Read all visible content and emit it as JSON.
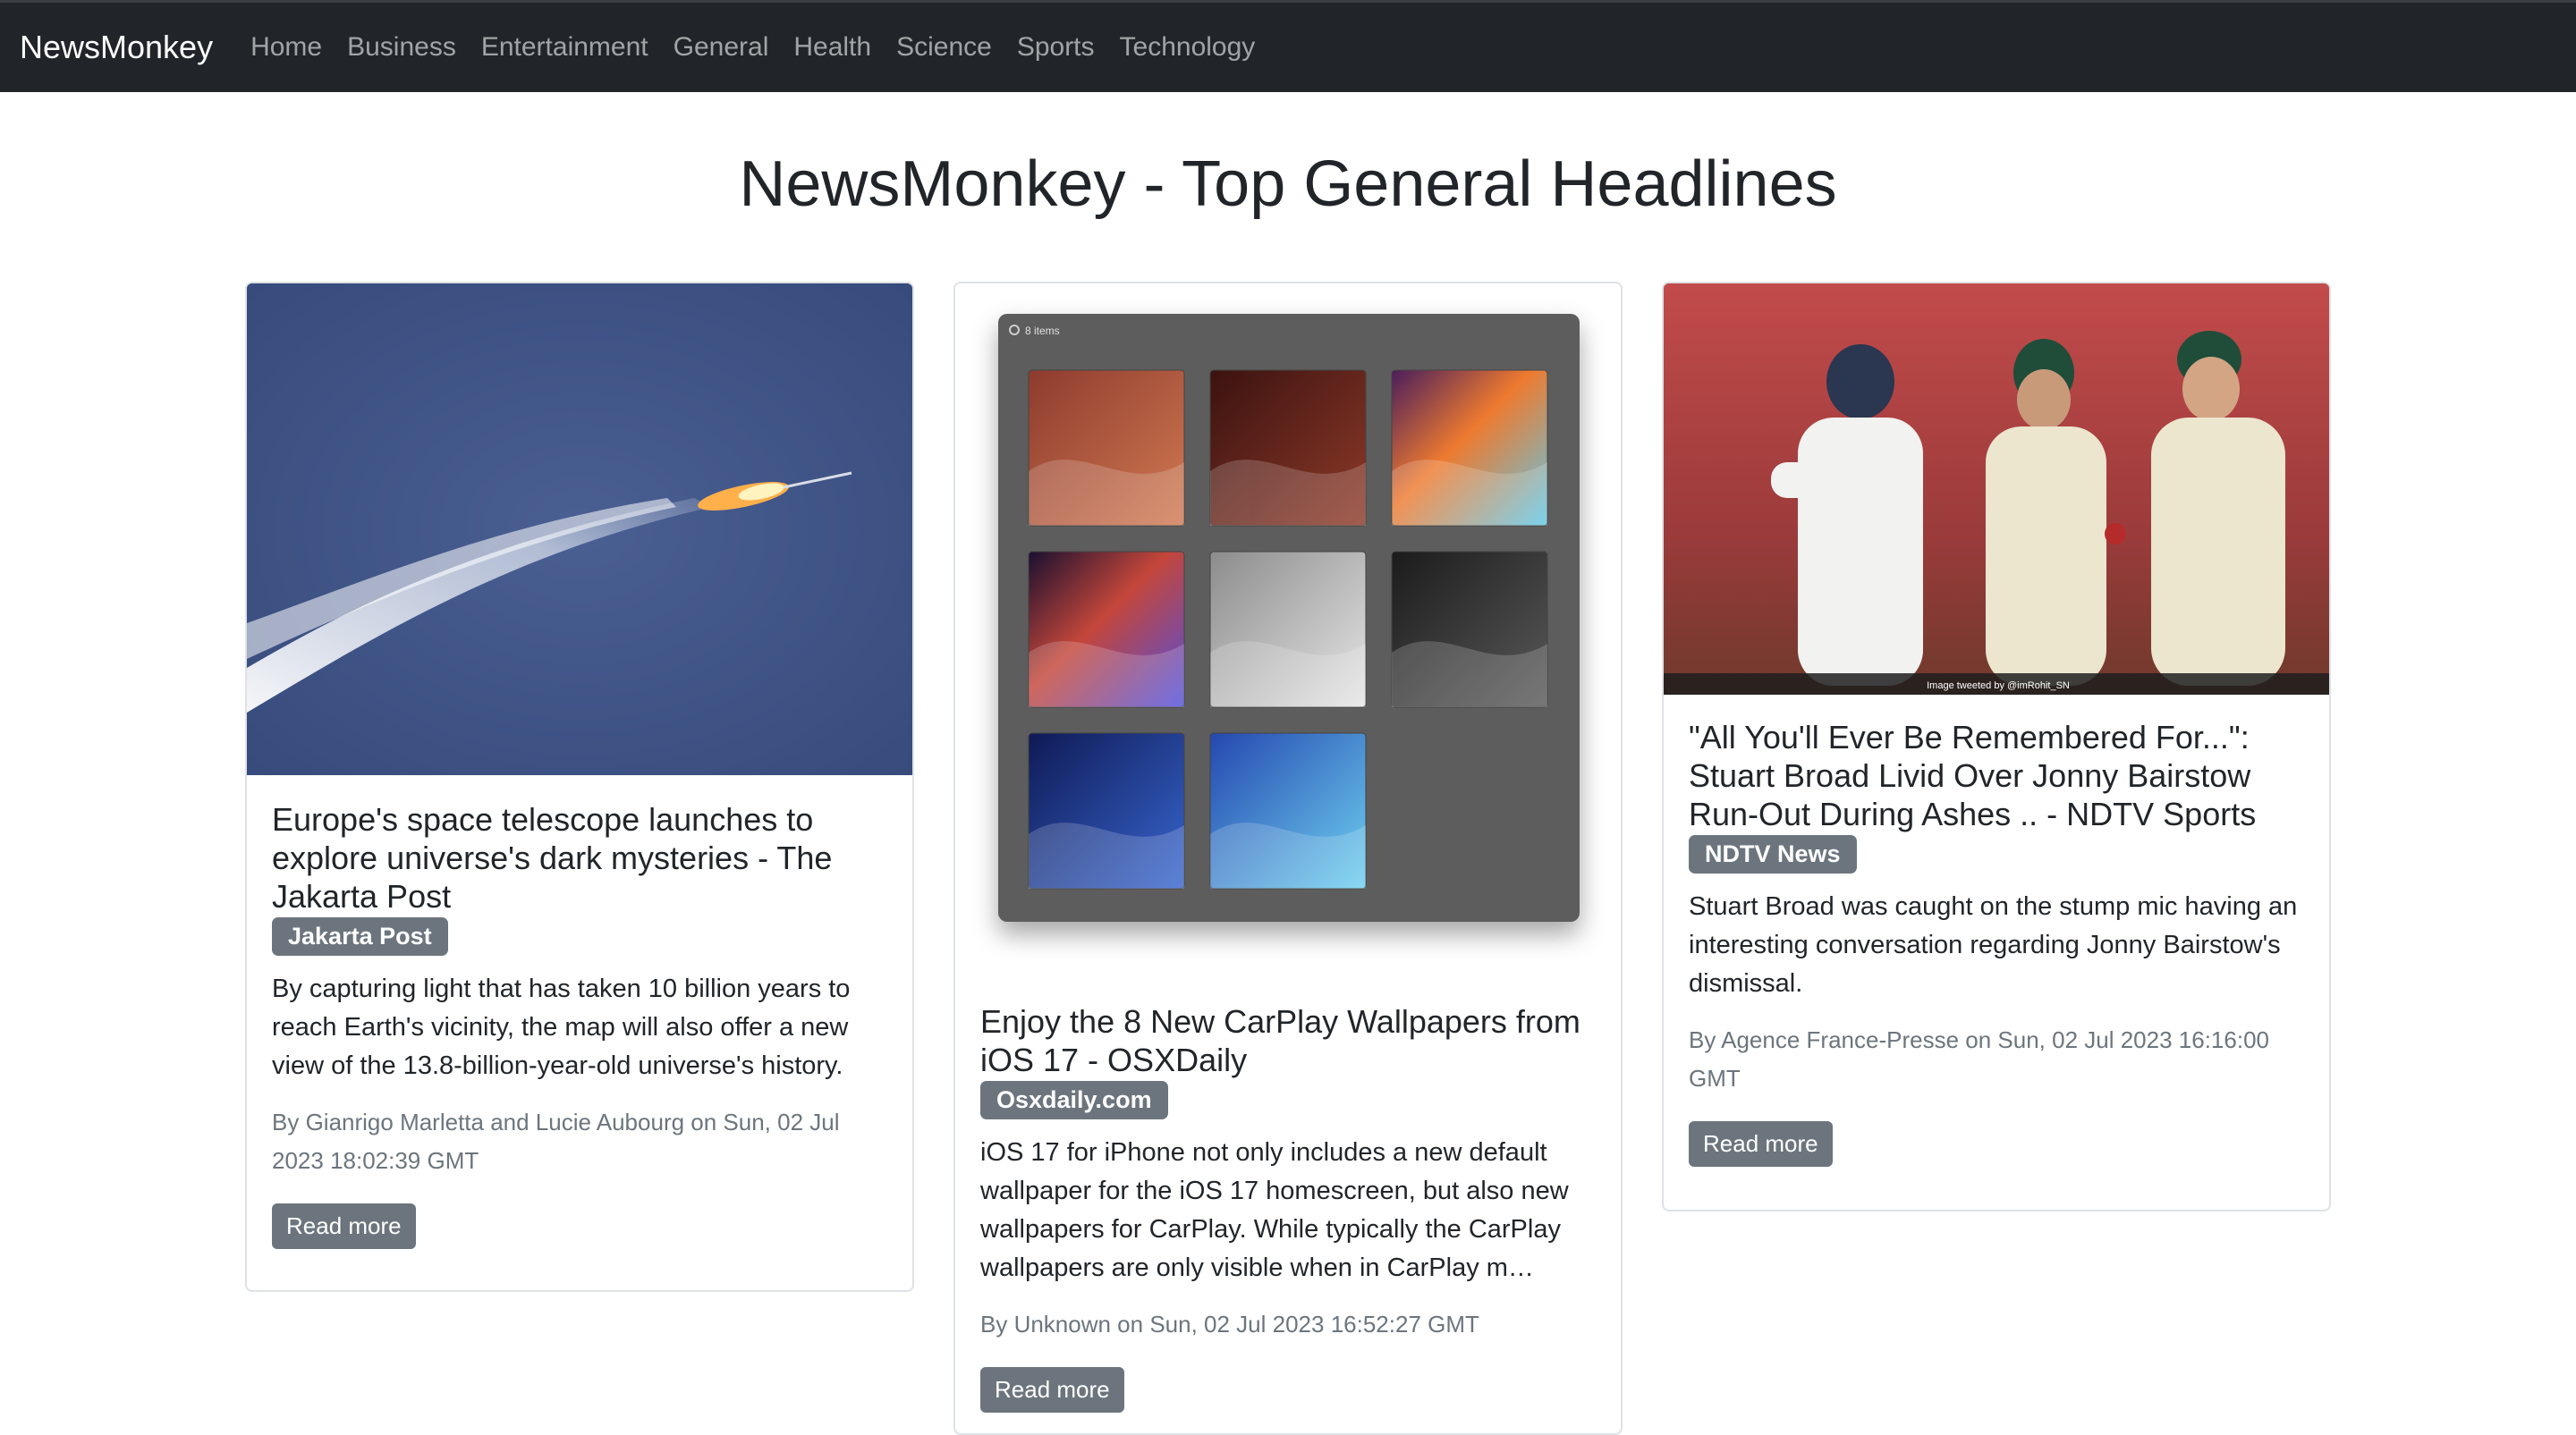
{
  "nav": {
    "brand": "NewsMonkey",
    "links": [
      "Home",
      "Business",
      "Entertainment",
      "General",
      "Health",
      "Science",
      "Sports",
      "Technology"
    ]
  },
  "page": {
    "title": "NewsMonkey - Top General Headlines"
  },
  "articles": [
    {
      "title": "Europe's space telescope launches to explore universe's dark mysteries - The Jakarta Post",
      "source": "Jakarta Post",
      "description": "By capturing light that has taken 10 billion years to reach Earth's vicinity, the map will also offer a new view of the 13.8-billion-year-old universe's history.",
      "meta": "By Gianrigo Marletta and Lucie Aubourg on Sun, 02 Jul 2023 18:02:39 GMT",
      "button": "Read more"
    },
    {
      "title": "Enjoy the 8 New CarPlay Wallpapers from iOS 17 - OSXDaily",
      "source": "Osxdaily.com",
      "description": "iOS 17 for iPhone not only includes a new default wallpaper for the iOS 17 homescreen, but also new wallpapers for CarPlay. While typically the CarPlay wallpapers are only visible when in CarPlay m…",
      "meta": "By Unknown on Sun, 02 Jul 2023 16:52:27 GMT",
      "button": "Read more",
      "image_text": "8 items"
    },
    {
      "title": "\"All You'll Ever Be Remembered For...\": Stuart Broad Livid Over Jonny Bairstow Run-Out During Ashes .. - NDTV Sports",
      "source": "NDTV News",
      "description": "Stuart Broad was caught on the stump mic having an interesting conversation regarding Jonny Bairstow's dismissal.",
      "meta": "By Agence France-Presse on Sun, 02 Jul 2023 16:16:00 GMT",
      "button": "Read more",
      "image_caption": "Image tweeted by @imRohit_SN"
    }
  ],
  "colors": {
    "navbar": "#212529",
    "badge": "#6c757d",
    "button": "#6c757d"
  }
}
